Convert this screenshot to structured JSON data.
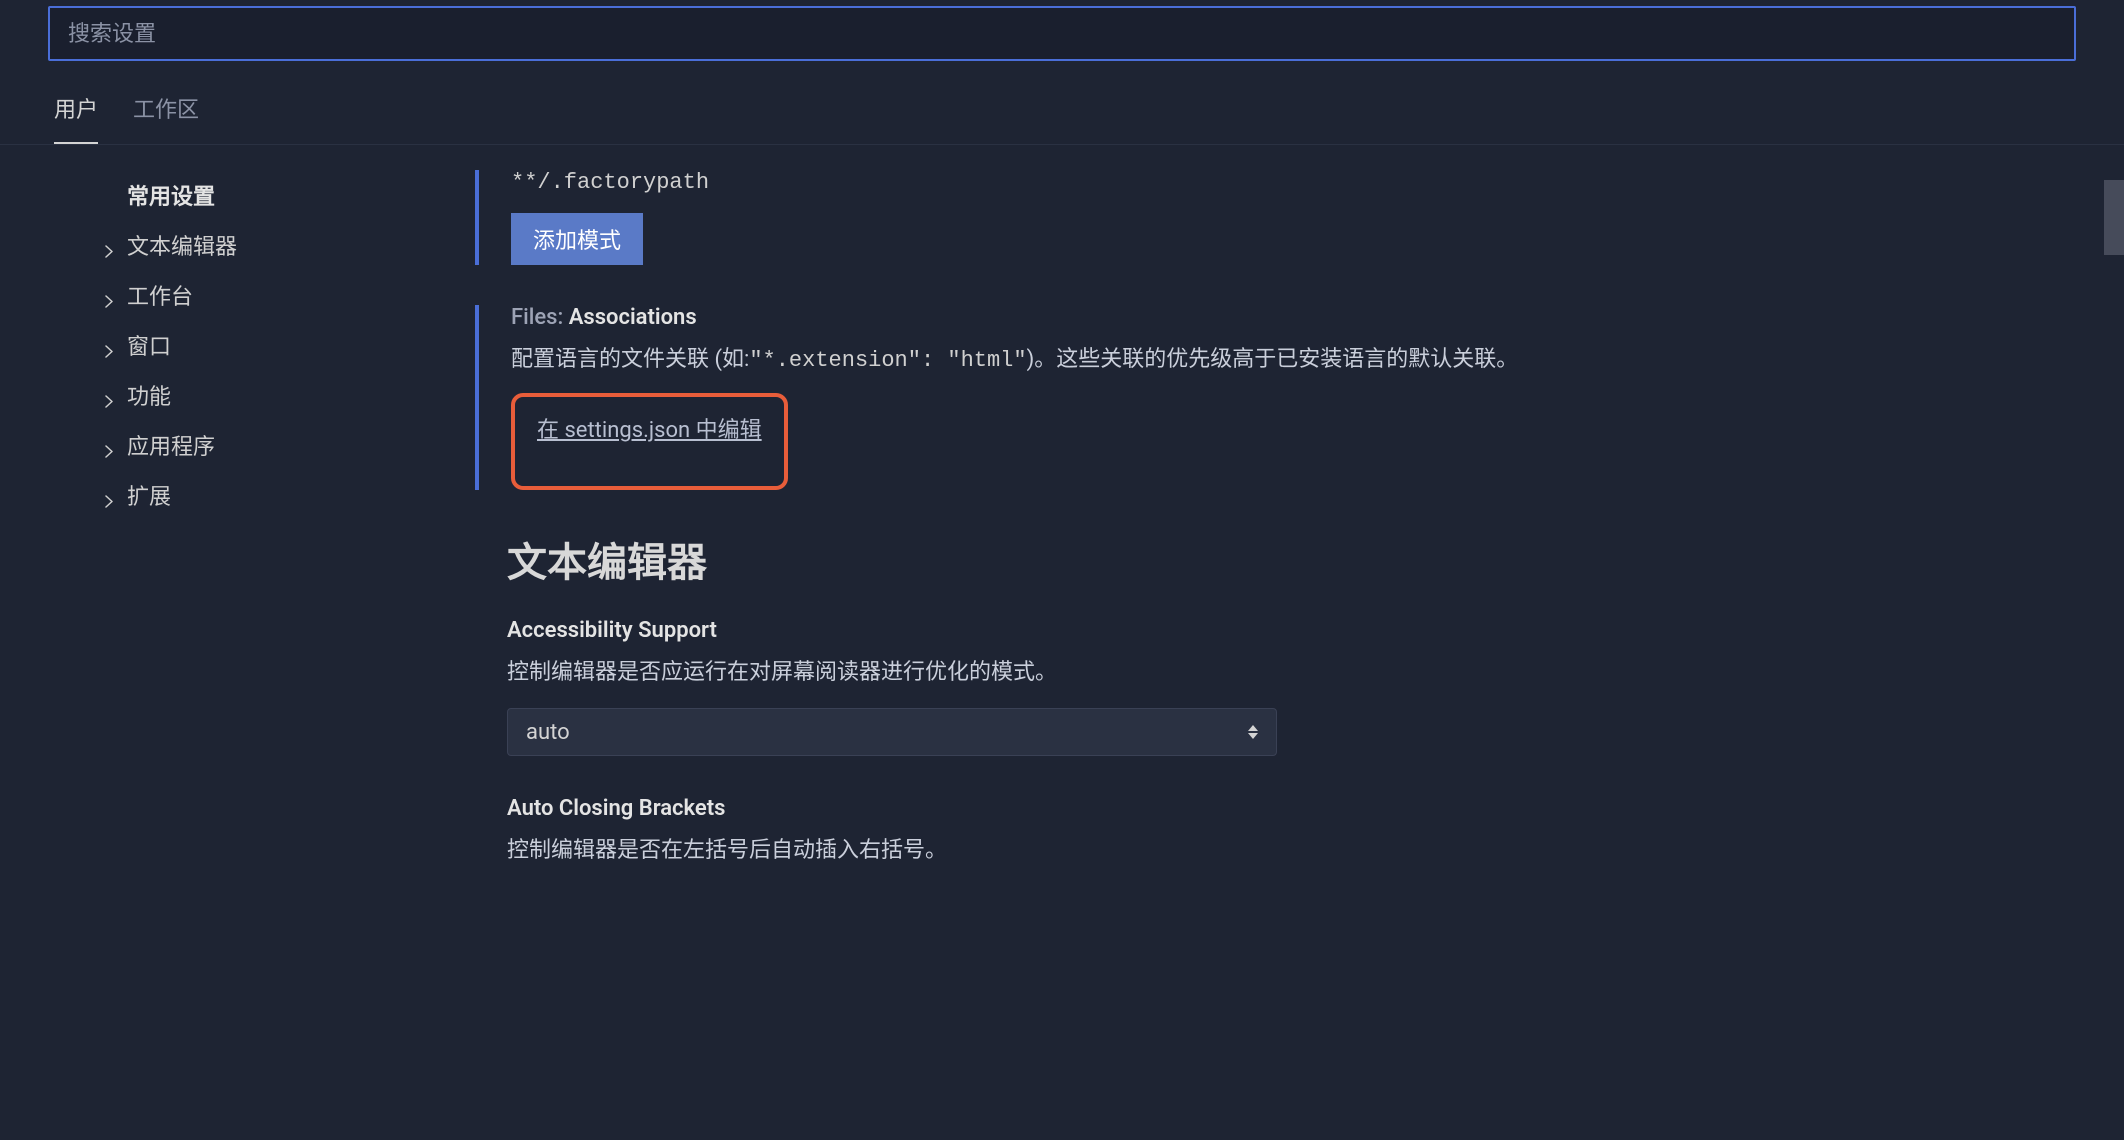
{
  "search": {
    "placeholder": "搜索设置"
  },
  "tabs": [
    {
      "label": "用户",
      "active": true
    },
    {
      "label": "工作区",
      "active": false
    }
  ],
  "sidebar": {
    "header": "常用设置",
    "items": [
      {
        "label": "文本编辑器"
      },
      {
        "label": "工作台"
      },
      {
        "label": "窗口"
      },
      {
        "label": "功能"
      },
      {
        "label": "应用程序"
      },
      {
        "label": "扩展"
      }
    ]
  },
  "settings": {
    "factorypath": {
      "code": "**/.factorypath",
      "button": "添加模式"
    },
    "associations": {
      "prefix": "Files:",
      "name": "Associations",
      "description_pre": "配置语言的文件关联 (如:",
      "description_code": "\"*.extension\": \"html\"",
      "description_post": ")。这些关联的优先级高于已安装语言的默认关联。",
      "edit_link": "在 settings.json 中编辑"
    },
    "section_heading": "文本编辑器",
    "accessibility": {
      "label": "Accessibility Support",
      "description": "控制编辑器是否应运行在对屏幕阅读器进行优化的模式。",
      "value": "auto"
    },
    "autoclosing": {
      "label": "Auto Closing Brackets",
      "description": "控制编辑器是否在左括号后自动插入右括号。"
    }
  }
}
